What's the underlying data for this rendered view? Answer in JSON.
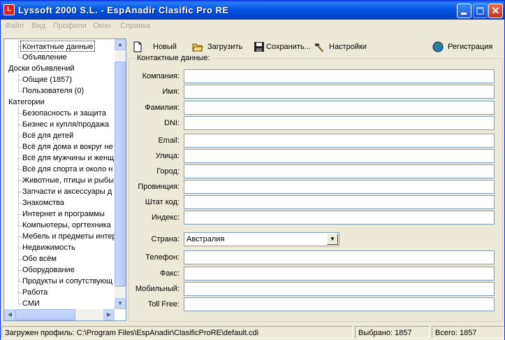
{
  "window": {
    "title": "Lyssoft 2000 S.L. - EspAnadir Clasific Pro RE",
    "app_icon": "L"
  },
  "menu": [
    "Файл",
    "Вид",
    "Профили",
    "Окно",
    "Справка"
  ],
  "tree": {
    "items": [
      {
        "label": "Контактные данные",
        "level": 1,
        "selected": true
      },
      {
        "label": "Объявление",
        "level": 1
      },
      {
        "label": "Доски объявлений",
        "level": 0
      },
      {
        "label": "Общие (1857)",
        "level": 1
      },
      {
        "label": "Пользователя (0)",
        "level": 1
      },
      {
        "label": "Категории",
        "level": 0
      },
      {
        "label": "Безопасность и защита",
        "level": 1
      },
      {
        "label": "Бизнес и купля/продажа",
        "level": 1
      },
      {
        "label": "Всё для детей",
        "level": 1
      },
      {
        "label": "Всё для дома и вокруг не",
        "level": 1
      },
      {
        "label": "Всё для мужчины и женщ",
        "level": 1
      },
      {
        "label": "Всё для спорта и около н",
        "level": 1
      },
      {
        "label": "Животные, птицы и рыбы",
        "level": 1
      },
      {
        "label": "Запчасти и аксессуары д",
        "level": 1
      },
      {
        "label": "Знакомства",
        "level": 1
      },
      {
        "label": "Интернет и программы",
        "level": 1
      },
      {
        "label": "Компьютеры, оргтехника",
        "level": 1
      },
      {
        "label": "Мебель и предметы интер",
        "level": 1
      },
      {
        "label": "Недвижимость",
        "level": 1
      },
      {
        "label": "Обо всём",
        "level": 1
      },
      {
        "label": "Оборудование",
        "level": 1
      },
      {
        "label": "Продукты и сопутствующ",
        "level": 1
      },
      {
        "label": "Работа",
        "level": 1
      },
      {
        "label": "СМИ",
        "level": 1
      }
    ]
  },
  "toolbar": {
    "new_label": "Новый",
    "load_label": "Загрузить",
    "save_label": "Сохранить...",
    "settings_label": "Настройки",
    "register_label": "Регистрация"
  },
  "form": {
    "group_title": "Контактные данные:",
    "fields": [
      {
        "label": "Компания:",
        "value": ""
      },
      {
        "label": "Имя:",
        "value": ""
      },
      {
        "label": "Фамилия:",
        "value": ""
      },
      {
        "label": "DNI:",
        "value": ""
      },
      {
        "label": "Email:",
        "value": ""
      },
      {
        "label": "Улица:",
        "value": ""
      },
      {
        "label": "Город:",
        "value": ""
      },
      {
        "label": "Провинция:",
        "value": ""
      },
      {
        "label": "Штат код:",
        "value": ""
      },
      {
        "label": "Индекс:",
        "value": ""
      }
    ],
    "country_label": "Страна:",
    "country_value": "Австралия",
    "fields2": [
      {
        "label": "Телефон:",
        "value": ""
      },
      {
        "label": "Факс:",
        "value": ""
      },
      {
        "label": "Мобильный:",
        "value": ""
      },
      {
        "label": "Toll Free:",
        "value": ""
      }
    ]
  },
  "status": {
    "profile": "Загружен профиль: C:\\Program Files\\EspAnadir\\ClasificProRE\\default.cdi",
    "selected": "Выбрано: 1857",
    "total": "Всего: 1857"
  }
}
